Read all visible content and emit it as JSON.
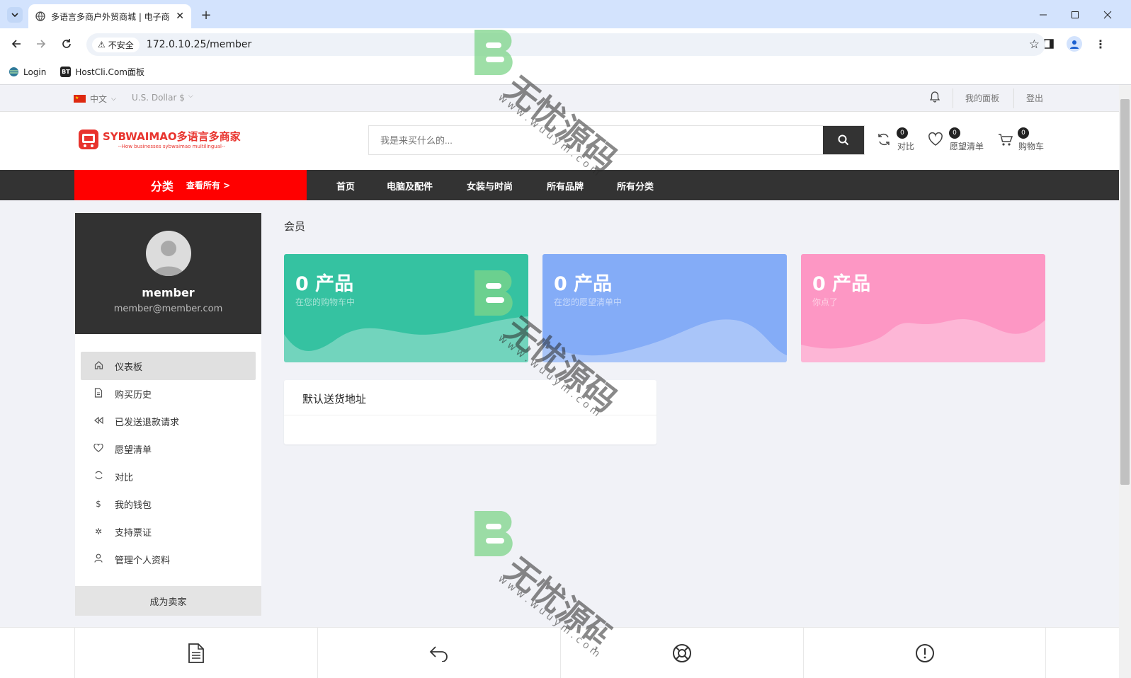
{
  "browser": {
    "tab_title": "多语言多商户外贸商城 | 电子商",
    "security_label": "不安全",
    "url": "172.0.10.25/member",
    "bookmarks": [
      {
        "label": "Login"
      },
      {
        "label": "HostCli.Com面板",
        "icon_text": "BT"
      }
    ]
  },
  "topbar": {
    "language": "中文",
    "currency": "U.S. Dollar $",
    "dashboard_link": "我的面板",
    "logout_link": "登出"
  },
  "header": {
    "logo_title": "SYBWAIMAO多语言多商家",
    "logo_tagline": "--How businesses sybwaimao multilingual--",
    "search_placeholder": "我是来买什么的...",
    "compare": {
      "label": "对比",
      "count": "0"
    },
    "wishlist": {
      "label": "愿望清单",
      "count": "0"
    },
    "cart": {
      "label": "购物车",
      "count": "0"
    }
  },
  "nav": {
    "category_label": "分类",
    "view_all": "查看所有 >",
    "items": [
      "首页",
      "电脑及配件",
      "女装与时尚",
      "所有品牌",
      "所有分类"
    ]
  },
  "sidebar": {
    "username": "member",
    "email": "member@member.com",
    "items": [
      {
        "label": "仪表板",
        "icon": "home-icon"
      },
      {
        "label": "购买历史",
        "icon": "document-icon"
      },
      {
        "label": "已发送退款请求",
        "icon": "rewind-icon"
      },
      {
        "label": "愿望清单",
        "icon": "heart-icon"
      },
      {
        "label": "对比",
        "icon": "refresh-icon"
      },
      {
        "label": "我的钱包",
        "icon": "dollar-icon"
      },
      {
        "label": "支持票证",
        "icon": "support-icon"
      },
      {
        "label": "管理个人资料",
        "icon": "user-icon"
      }
    ],
    "become_seller": "成为卖家"
  },
  "main": {
    "page_title": "会员",
    "cards": [
      {
        "value": "0 产品",
        "subtitle": "在您的购物车中",
        "color": "#35c2a1"
      },
      {
        "value": "0 产品",
        "subtitle": "在您的愿望清单中",
        "color": "#84acf7"
      },
      {
        "value": "0 产品",
        "subtitle": "你点了",
        "color": "#fd97c4"
      }
    ],
    "address_title": "默认送货地址"
  },
  "watermark": {
    "text": "无忧源码",
    "url": "w w w . w u u y m . c o m"
  },
  "colors": {
    "accent": "#ff0000",
    "nav_bg": "#333333"
  }
}
